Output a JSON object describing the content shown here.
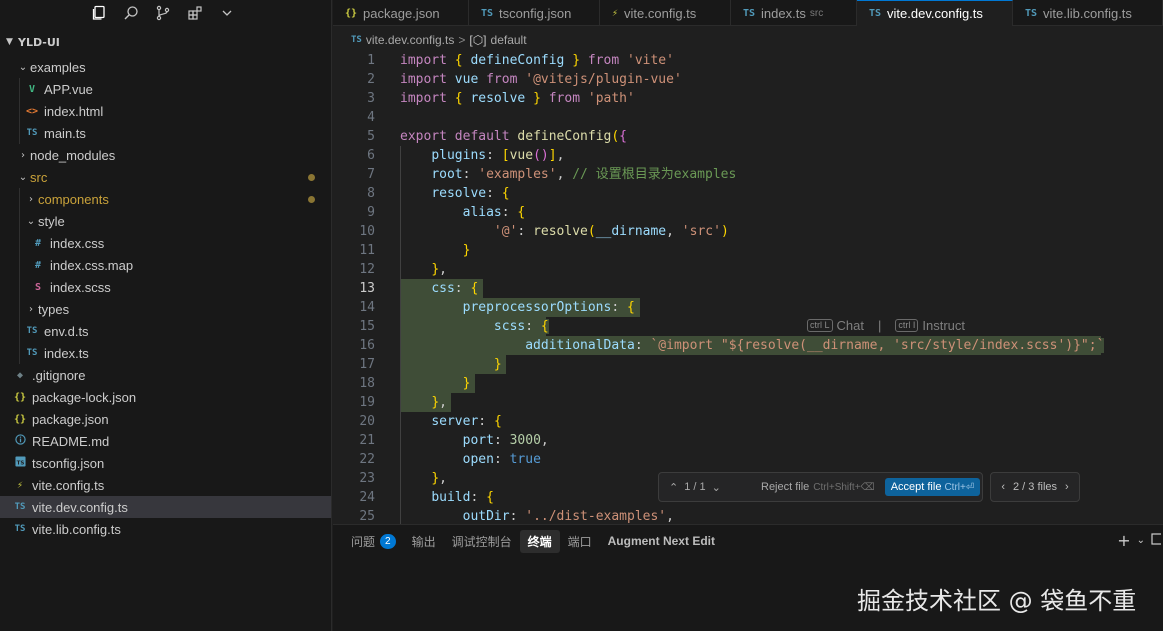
{
  "toolbar": {
    "icons": [
      "explorer-icon",
      "search-icon",
      "source-control-icon",
      "extensions-icon",
      "chevron-down-icon"
    ]
  },
  "explorer": {
    "root": "YLD-UI",
    "items": [
      {
        "label": "examples",
        "type": "folder",
        "open": true
      },
      {
        "label": "APP.vue",
        "icon": "V"
      },
      {
        "label": "index.html",
        "icon": "<>"
      },
      {
        "label": "main.ts",
        "icon": "TS"
      },
      {
        "label": "node_modules",
        "type": "folder",
        "open": false
      },
      {
        "label": "src",
        "type": "folder",
        "open": true
      },
      {
        "label": "components",
        "type": "folder",
        "open": false
      },
      {
        "label": "style",
        "type": "folder",
        "open": true
      },
      {
        "label": "index.css",
        "icon": "#"
      },
      {
        "label": "index.css.map",
        "icon": "#"
      },
      {
        "label": "index.scss",
        "icon": "S"
      },
      {
        "label": "types",
        "type": "folder",
        "open": false
      },
      {
        "label": "env.d.ts",
        "icon": "TS"
      },
      {
        "label": "index.ts",
        "icon": "TS"
      },
      {
        "label": ".gitignore",
        "icon": "◆"
      },
      {
        "label": "package-lock.json",
        "icon": "{}"
      },
      {
        "label": "package.json",
        "icon": "{}"
      },
      {
        "label": "README.md",
        "icon": "i"
      },
      {
        "label": "tsconfig.json",
        "icon": "TS"
      },
      {
        "label": "vite.config.ts",
        "icon": "⚡"
      },
      {
        "label": "vite.dev.config.ts",
        "icon": "TS"
      },
      {
        "label": "vite.lib.config.ts",
        "icon": "TS"
      }
    ]
  },
  "tabs": [
    {
      "icon": "{}",
      "label": "package.json",
      "sub": ""
    },
    {
      "icon": "TS",
      "label": "tsconfig.json",
      "sub": ""
    },
    {
      "icon": "⚡",
      "label": "vite.config.ts",
      "sub": ""
    },
    {
      "icon": "TS",
      "label": "index.ts",
      "sub": "src"
    },
    {
      "icon": "TS",
      "label": "vite.dev.config.ts",
      "sub": "",
      "active": true
    },
    {
      "icon": "TS",
      "label": "vite.lib.config.ts",
      "sub": ""
    }
  ],
  "breadcrumb": {
    "file_icon": "TS",
    "file": "vite.dev.config.ts",
    "separator": ">",
    "symbol_icon": "[⬡]",
    "symbol": "default"
  },
  "editor": {
    "line_numbers": [
      "1",
      "2",
      "3",
      "4",
      "5",
      "6",
      "7",
      "8",
      "9",
      "10",
      "11",
      "12",
      "13",
      "14",
      "15",
      "16",
      "17",
      "18",
      "19",
      "20",
      "21",
      "22",
      "23",
      "24",
      "25"
    ],
    "current_line": "13",
    "lines": [
      "import { defineConfig } from 'vite'",
      "import vue from '@vitejs/plugin-vue'",
      "import { resolve } from 'path'",
      "",
      "export default defineConfig({",
      "    plugins: [vue()],",
      "    root: 'examples', // 设置根目录为examples",
      "    resolve: {",
      "        alias: {",
      "            '@': resolve(__dirname, 'src')",
      "        }",
      "    },",
      "    css: {",
      "        preprocessorOptions: {",
      "            scss: {",
      "                additionalData: `@import \"${resolve(__dirname, 'src/style/index.scss')}\";`",
      "            }",
      "        }",
      "    },",
      "    server: {",
      "        port: 3000,",
      "        open: true",
      "    },",
      "    build: {",
      "        outDir: '../dist-examples',"
    ],
    "inline_hint": {
      "chat_key": "ctrl L",
      "chat_label": "Chat",
      "divider": "|",
      "instruct_key": "ctrl I",
      "instruct_label": "Instruct"
    }
  },
  "review_widget": {
    "counter": "1 / 1",
    "reject_label": "Reject file",
    "reject_shortcut": "Ctrl+Shift+⌫",
    "accept_label": "Accept file",
    "accept_shortcut": "Ctrl+⏎",
    "files_counter": "2 / 3 files"
  },
  "panel": {
    "tabs": [
      {
        "label": "问题",
        "badge": "2"
      },
      {
        "label": "输出"
      },
      {
        "label": "调试控制台"
      },
      {
        "label": "终端",
        "active": true
      },
      {
        "label": "端口"
      },
      {
        "label": "Augment Next Edit"
      }
    ]
  },
  "watermark": "掘金技术社区 @ 袋鱼不重",
  "colors": {
    "accent": "#0078d4",
    "selection_highlight": "#3f4d37",
    "modified": "#c9a23a"
  }
}
